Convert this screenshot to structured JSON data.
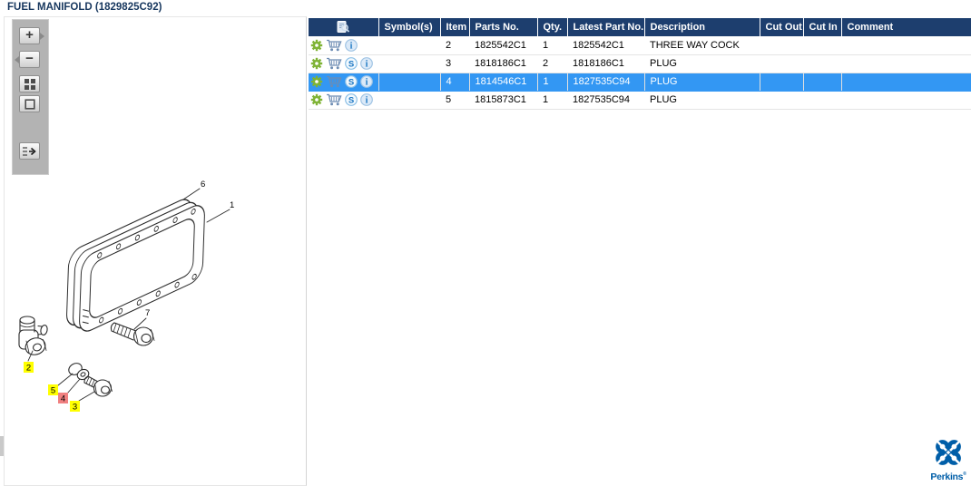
{
  "title": "FUEL MANIFOLD (1829825C92)",
  "toolbar": {
    "buttons": [
      {
        "name": "zoom-in",
        "glyph": "+"
      },
      {
        "name": "zoom-out",
        "glyph": "−"
      },
      {
        "name": "tile-view"
      },
      {
        "name": "zoom-region"
      },
      {
        "name": "toggle-panel"
      }
    ]
  },
  "table": {
    "columns": [
      "",
      "Symbol(s)",
      "Item",
      "Parts No.",
      "Qty.",
      "Latest Part No.",
      "Description",
      "Cut Out",
      "Cut In",
      "Comment"
    ],
    "rows": [
      {
        "icons": [
          "gear",
          "cart",
          "info"
        ],
        "symbols": "",
        "item": "2",
        "parts_no": "1825542C1",
        "qty": "1",
        "latest_part_no": "1825542C1",
        "description": "THREE WAY COCK",
        "cut_out": "",
        "cut_in": "",
        "comment": "",
        "selected": false
      },
      {
        "icons": [
          "gear",
          "cart",
          "s",
          "info"
        ],
        "symbols": "",
        "item": "3",
        "parts_no": "1818186C1",
        "qty": "2",
        "latest_part_no": "1818186C1",
        "description": "PLUG",
        "cut_out": "",
        "cut_in": "",
        "comment": "",
        "selected": false
      },
      {
        "icons": [
          "gear",
          "cart",
          "s",
          "info"
        ],
        "symbols": "",
        "item": "4",
        "parts_no": "1814546C1",
        "qty": "1",
        "latest_part_no": "1827535C94",
        "description": "PLUG",
        "cut_out": "",
        "cut_in": "",
        "comment": "",
        "selected": true
      },
      {
        "icons": [
          "gear",
          "cart",
          "s",
          "info"
        ],
        "symbols": "",
        "item": "5",
        "parts_no": "1815873C1",
        "qty": "1",
        "latest_part_no": "1827535C94",
        "description": "PLUG",
        "cut_out": "",
        "cut_in": "",
        "comment": "",
        "selected": false
      }
    ]
  },
  "diagram": {
    "callouts": [
      {
        "label": "6",
        "highlight": "none"
      },
      {
        "label": "1",
        "highlight": "none"
      },
      {
        "label": "7",
        "highlight": "none"
      },
      {
        "label": "2",
        "highlight": "yellow"
      },
      {
        "label": "5",
        "highlight": "yellow"
      },
      {
        "label": "4",
        "highlight": "red"
      },
      {
        "label": "3",
        "highlight": "yellow"
      }
    ]
  },
  "logo": {
    "text": "Perkins",
    "mark": "®"
  },
  "colors": {
    "header_bg": "#1d3e6e",
    "selected_row": "#3397f3",
    "title_text": "#17375e",
    "highlight_yellow": "#ffff00",
    "highlight_red": "#f08080",
    "perkins_blue": "#005ea8",
    "gear_green": "#7fb335",
    "cart_blue": "#6d8cb3"
  }
}
